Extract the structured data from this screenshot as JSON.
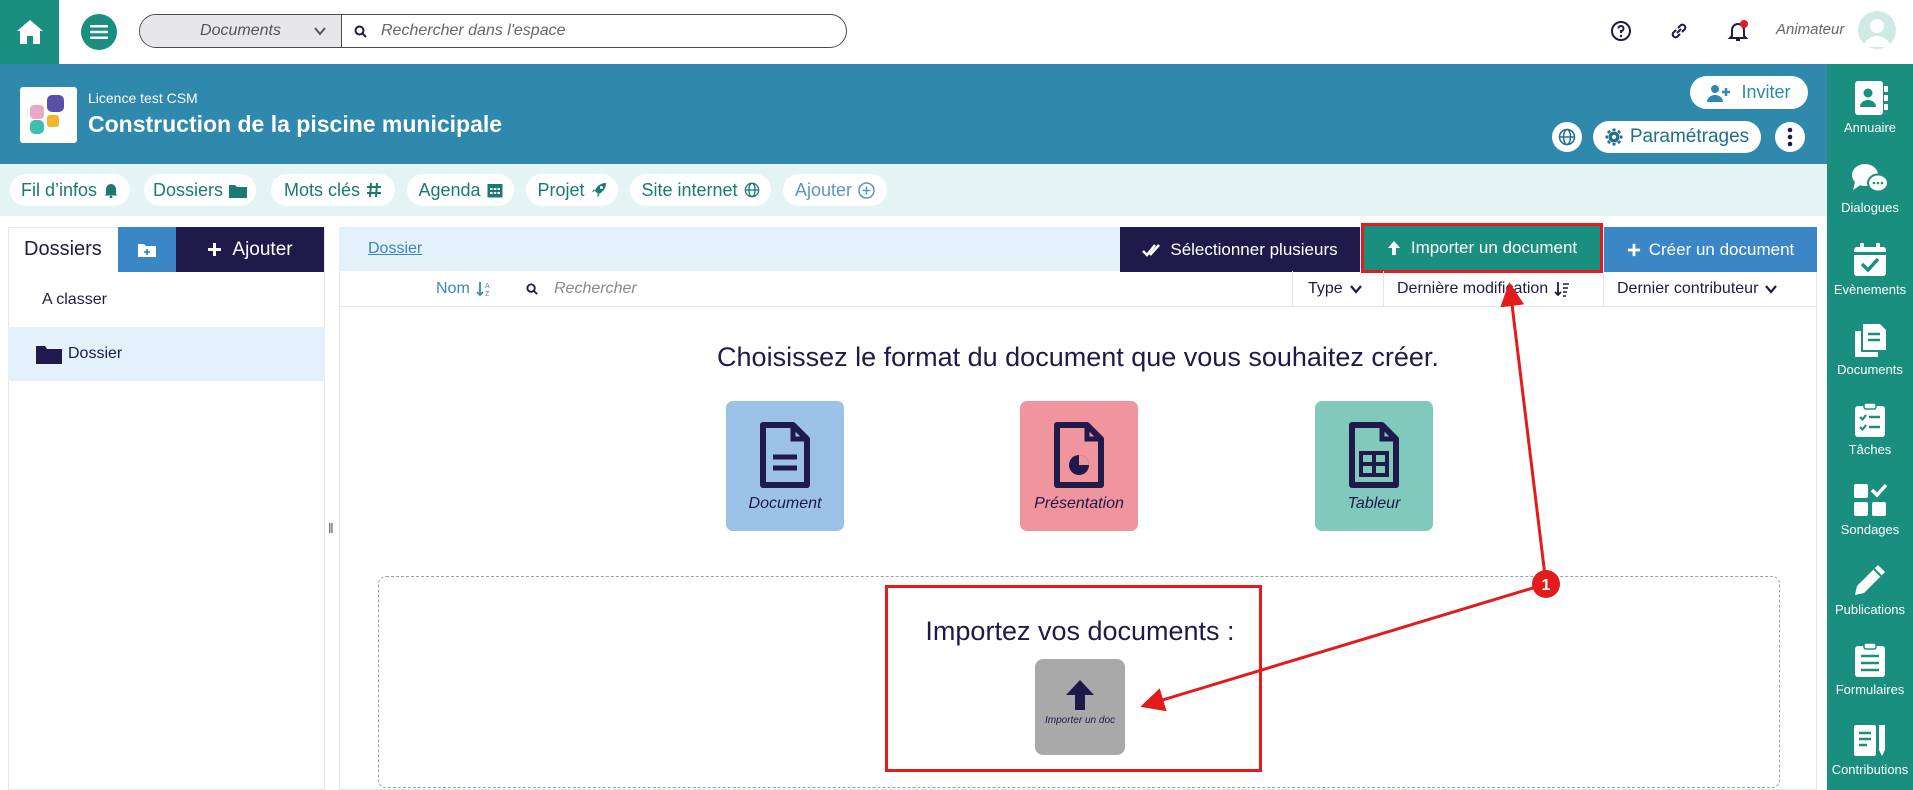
{
  "topbar": {
    "search_scope": "Documents",
    "search_placeholder": "Rechercher dans l'espace",
    "role": "Animateur"
  },
  "banner": {
    "licence": "Licence test CSM",
    "title": "Construction de la piscine municipale",
    "invite_label": "Inviter",
    "settings_label": "Paramétrages"
  },
  "tabs": [
    {
      "label": "Fil d’infos"
    },
    {
      "label": "Dossiers"
    },
    {
      "label": "Mots clés"
    },
    {
      "label": "Agenda"
    },
    {
      "label": "Projet"
    },
    {
      "label": "Site internet"
    },
    {
      "label": "Ajouter"
    }
  ],
  "left_panel": {
    "title": "Dossiers",
    "add_label": "Ajouter",
    "items": [
      {
        "label": "A classer"
      },
      {
        "label": "Dossier"
      }
    ]
  },
  "main": {
    "breadcrumb": "Dossier",
    "select_multiple_label": "Sélectionner plusieurs",
    "import_label": "Importer un document",
    "create_label": "Créer un document",
    "columns": {
      "name": "Nom",
      "search_placeholder": "Rechercher",
      "type": "Type",
      "last_modified": "Dernière modification",
      "last_contributor": "Dernier contributeur"
    },
    "choose_title": "Choisissez le format du document que vous souhaitez créer.",
    "formats": [
      {
        "label": "Document",
        "color": "#9cc2e8"
      },
      {
        "label": "Présentation",
        "color": "#f0949e"
      },
      {
        "label": "Tableur",
        "color": "#82c9bd"
      }
    ],
    "import_title": "Importez vos documents :",
    "import_tile_label": "Importer un doc"
  },
  "annotation": {
    "number": "1",
    "color": "#e21b1b"
  },
  "sidebar": {
    "items": [
      {
        "label": "Annuaire",
        "icon": "contacts-icon"
      },
      {
        "label": "Dialogues",
        "icon": "chat-icon"
      },
      {
        "label": "Evènements",
        "icon": "calendar-check-icon"
      },
      {
        "label": "Documents",
        "icon": "documents-icon"
      },
      {
        "label": "Tâches",
        "icon": "tasks-icon"
      },
      {
        "label": "Sondages",
        "icon": "poll-icon"
      },
      {
        "label": "Publications",
        "icon": "pen-icon"
      },
      {
        "label": "Formulaires",
        "icon": "form-icon"
      },
      {
        "label": "Contributions",
        "icon": "contributions-icon"
      }
    ]
  }
}
